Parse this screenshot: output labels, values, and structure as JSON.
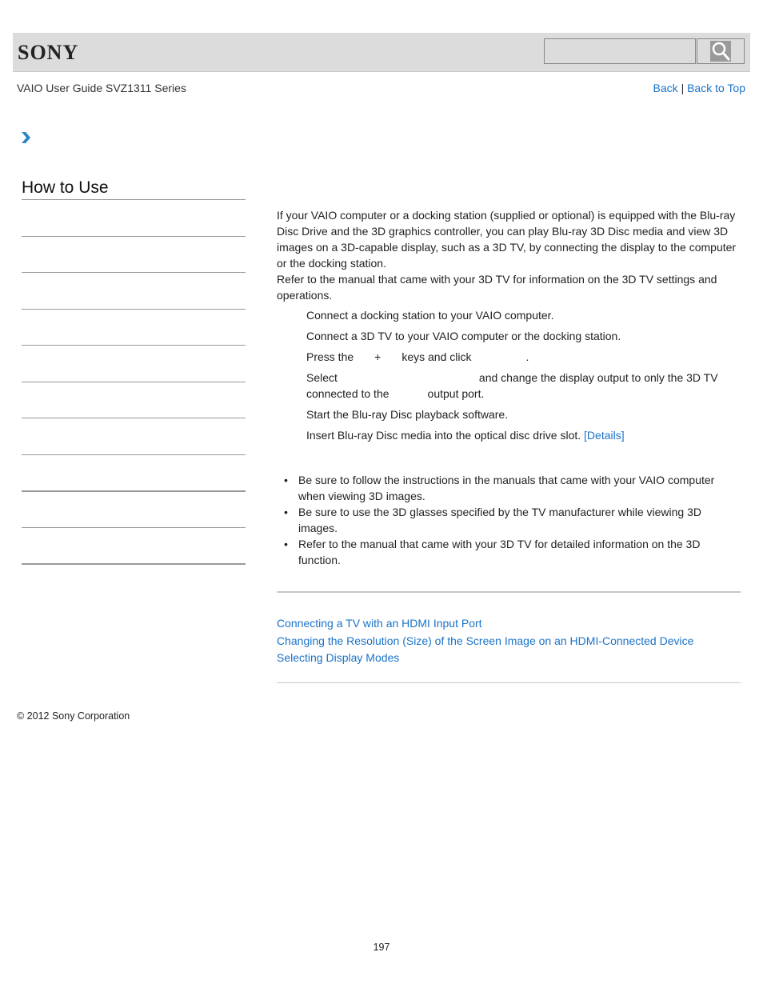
{
  "header": {
    "logo": "SONY",
    "search": {
      "placeholder": "",
      "value": ""
    },
    "search_icon": "search-icon"
  },
  "subheader": {
    "guide_title": "VAIO User Guide SVZ1311 Series",
    "nav": {
      "back": "Back",
      "separator": "|",
      "back_to_top": "Back to Top"
    }
  },
  "breadcrumb": {
    "icon": "chevron-right-icon"
  },
  "sidebar": {
    "title": "How to Use",
    "items": [
      "",
      "",
      "",
      "",
      "",
      "",
      "",
      "",
      "",
      ""
    ]
  },
  "main": {
    "intro": [
      "If your VAIO computer or a docking station (supplied or optional) is equipped with the Blu-ray Disc Drive and the 3D graphics controller, you can play Blu-ray 3D Disc media and view 3D images on a 3D-capable display, such as a 3D TV, by connecting the display to the computer or the docking station.",
      "Refer to the manual that came with your 3D TV for information on the 3D TV settings and operations."
    ],
    "steps": [
      {
        "text": "Connect a docking station to your VAIO computer."
      },
      {
        "text": "Connect a 3D TV to your VAIO computer or the docking station."
      },
      {
        "part1": "Press the",
        "part2": "+",
        "part3": "keys and click",
        "part4": "."
      },
      {
        "part1": "Select",
        "part2": "and change the display output to only the 3D TV connected to the",
        "part3": "output port."
      },
      {
        "text": "Start the Blu-ray Disc playback software."
      },
      {
        "text": "Insert Blu-ray Disc media into the optical disc drive slot.",
        "link": "[Details]"
      }
    ],
    "notes": [
      "Be sure to follow the instructions in the manuals that came with your VAIO computer when viewing 3D images.",
      "Be sure to use the 3D glasses specified by the TV manufacturer while viewing 3D images.",
      "Refer to the manual that came with your 3D TV for detailed information on the 3D function."
    ],
    "related_links": [
      "Connecting a TV with an HDMI Input Port",
      "Changing the Resolution (Size) of the Screen Image on an HDMI-Connected Device",
      "Selecting Display Modes"
    ]
  },
  "footer": {
    "copyright": "© 2012 Sony Corporation",
    "page_number": "197"
  },
  "colors": {
    "link": "#1a73c8",
    "header_bg": "#dcdcdc",
    "chevron": "#2a86c8"
  }
}
